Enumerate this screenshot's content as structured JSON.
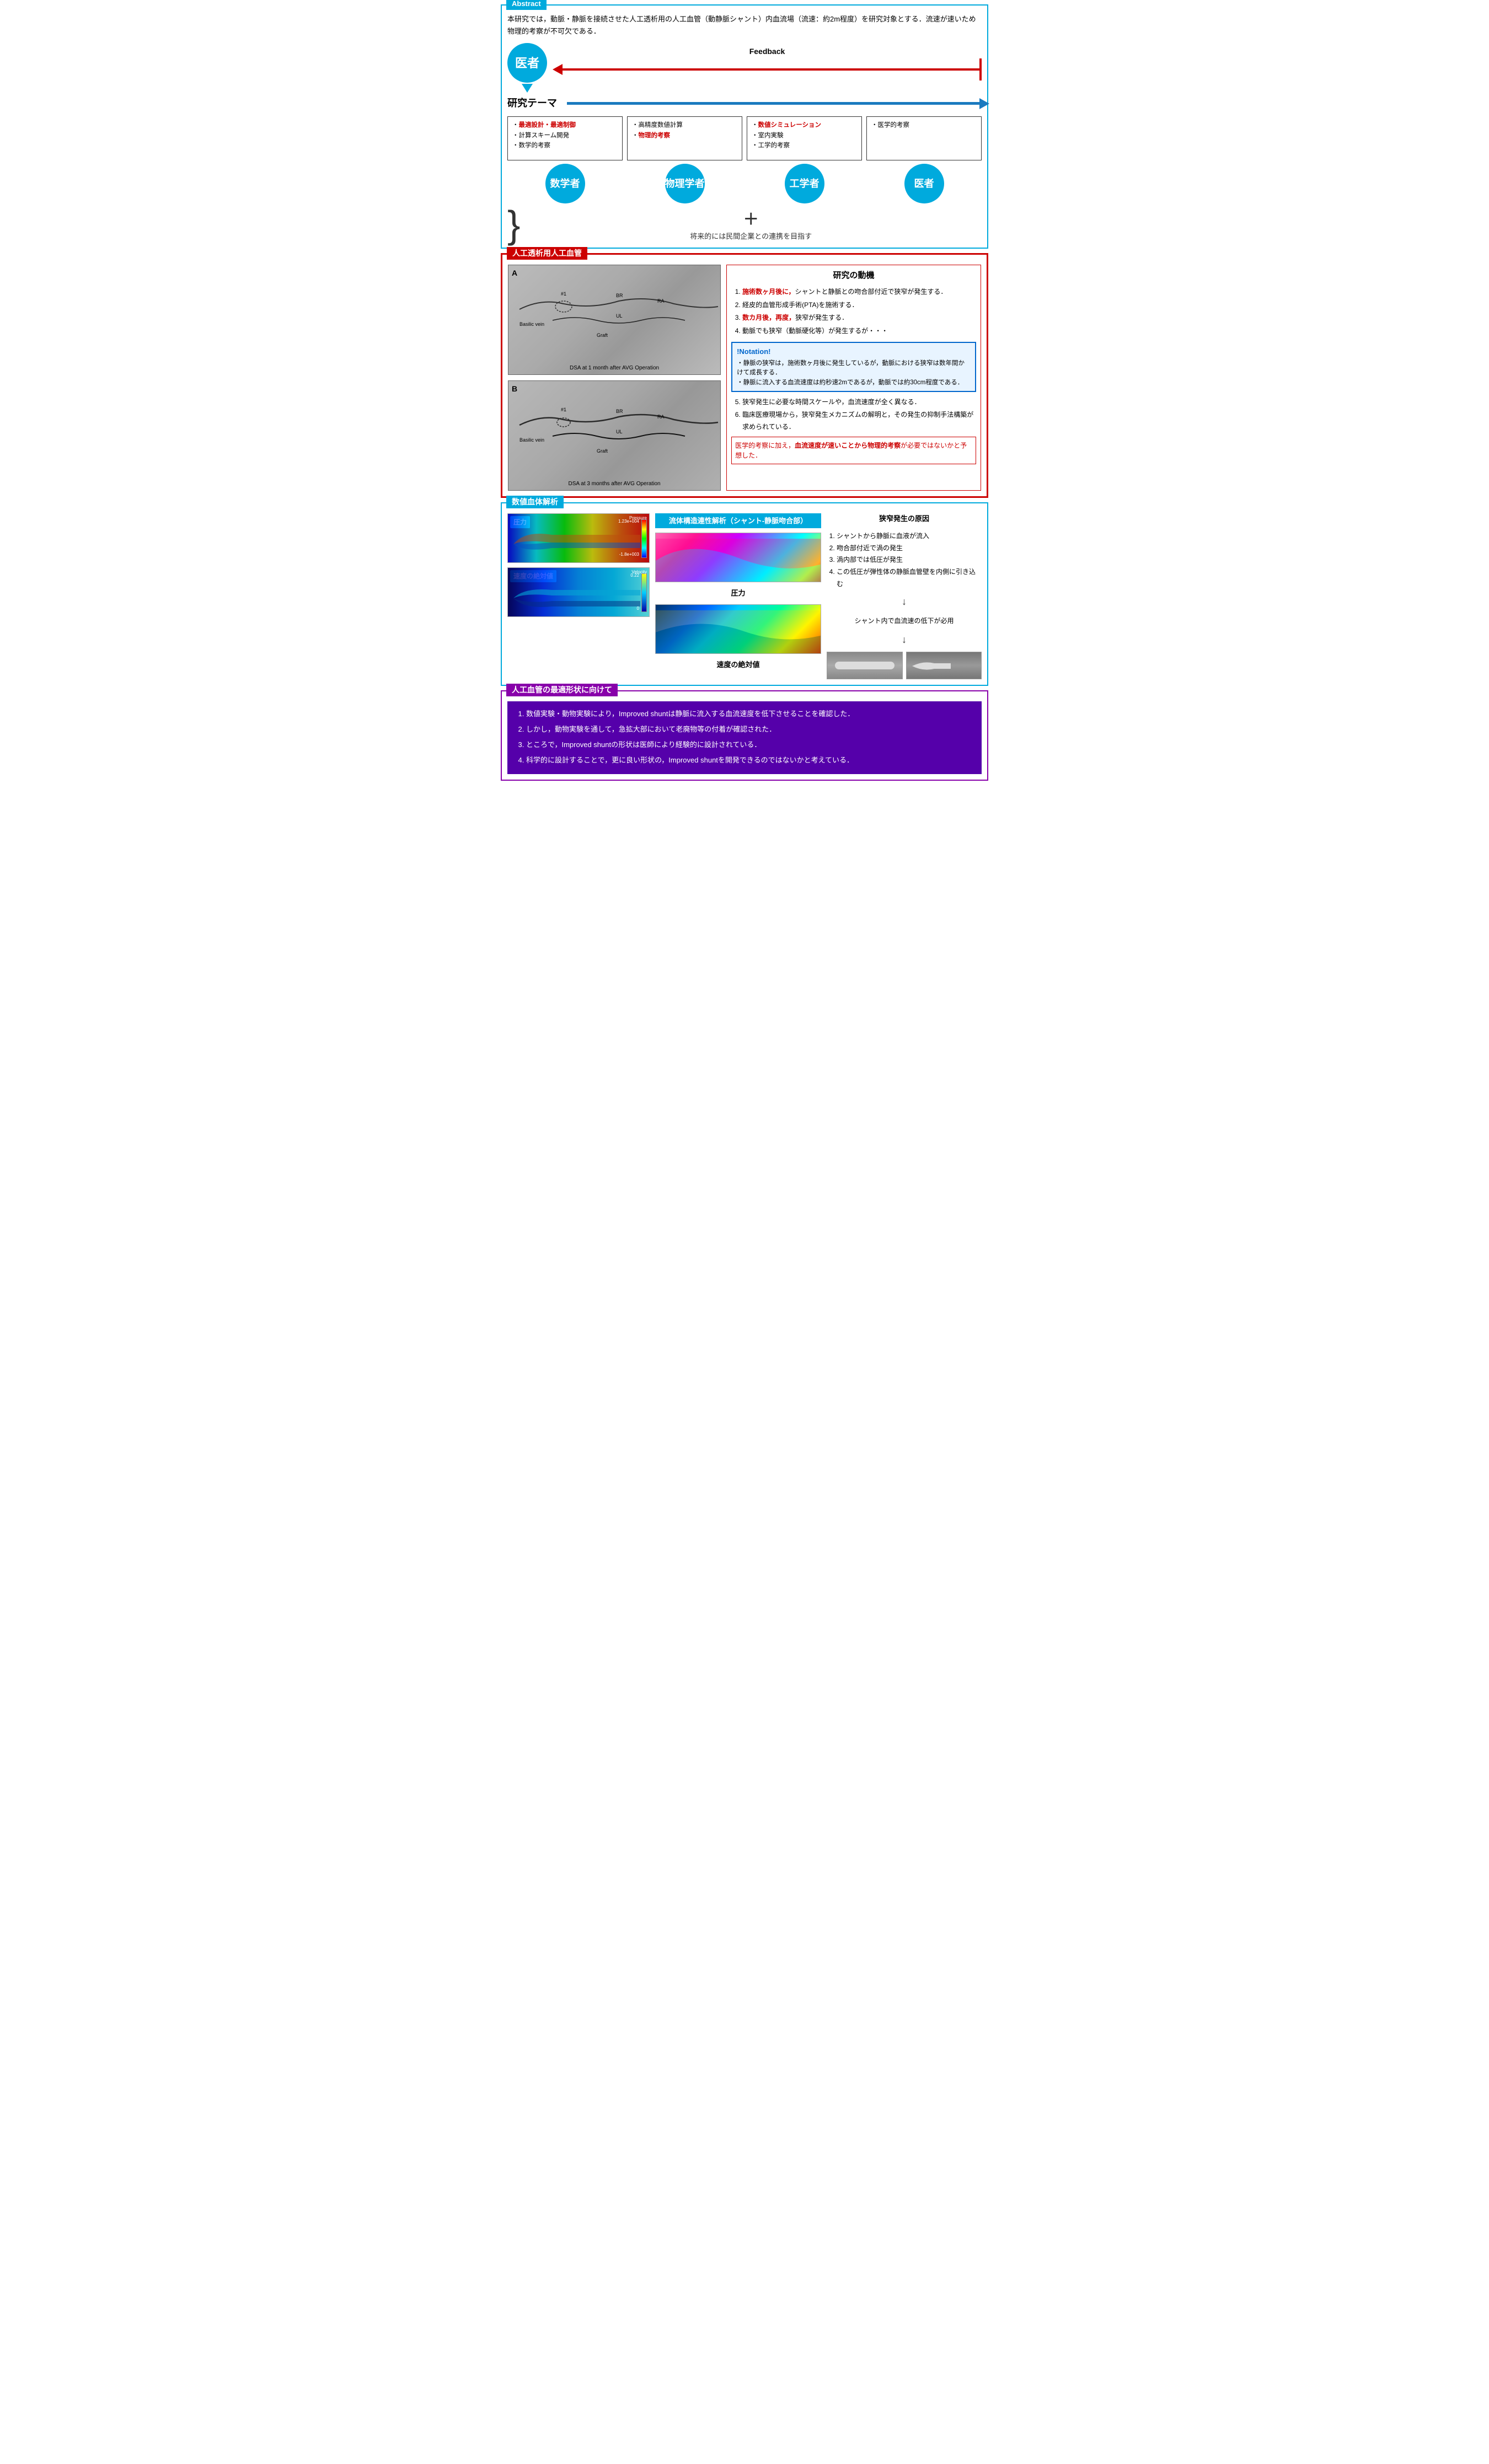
{
  "abstract": {
    "label": "Abstract",
    "text": "本研究では，動脈・静脈を接続させた人工透析用の人工血管（動静脈シャント）内血流場（流速：約2m程度）を研究対象とする．流速が速いため物理的考察が不可欠である．",
    "feedback_label": "Feedback",
    "theme_label": "研究テーマ",
    "collaboration": "将来的には民間企業との連携を目指す",
    "isha": "医者",
    "math": "数学者",
    "physics": "物理学者",
    "engineering": "工学者",
    "medicine": "医者",
    "math_items": [
      "最適設計・最適制御",
      "計算スキーム開発",
      "数学的考察"
    ],
    "physics_items": [
      "高精度数値計算",
      "物理的考察"
    ],
    "engineering_items": [
      "数値シミュレーション",
      "室内実験",
      "工学的考察"
    ],
    "medicine_items": [
      "医学的考察"
    ],
    "math_red": [
      0
    ],
    "physics_red": [
      1
    ],
    "engineering_red": [
      0
    ]
  },
  "hemodialysis": {
    "section_label": "人工透析用人工血管",
    "dsa_a_caption": "DSA at 1 month after AVG Operation",
    "dsa_b_caption": "DSA at 3 months after AVG Operation",
    "dsa_labels": [
      "Basilic vein",
      "BR",
      "UL",
      "RA",
      "Graft",
      "#1"
    ],
    "motivation_title": "研究の動機",
    "motivation_items": [
      "施術数ヶ月後に，シャントと静脈との吻合部付近で狭窄が発生する．",
      "経皮的血管形成手術(PTA)を施術する．",
      "数カ月後，再度，狭窄が発生する．",
      "動脈でも狭窄（動脈硬化等）が発生するが・・・"
    ],
    "motivation_red": [
      0,
      2
    ],
    "notation_title": "!Notation!",
    "notation_items": [
      "静脈の狭窄は，施術数ヶ月後に発生しているが，動脈における狭窄は数年間かけて成長する．",
      "静脈に流入する血流速度は約秒速2mであるが，動脈では約30cm程度である．"
    ],
    "motivation_items2": [
      "狭窄発生に必要な時間スケールや，血流速度が全く異なる．",
      "臨床医療現場から，狭窄発生メカニズムの解明と，その発生の抑制手法構築が求められている．"
    ],
    "footer": "医学的考察に加え，血流速度が速いことから物理的考察が必要ではないかと予想した．"
  },
  "numerical": {
    "section_label": "数値血体解析",
    "pressure_label": "圧力",
    "velocity_label": "速度の絶対値",
    "middle_title": "流体構造連性解析（シャント-静脈吻合部）",
    "middle_pressure": "圧力",
    "middle_velocity": "速度の絶対値",
    "pressure_max": "1.23e+004",
    "pressure_min": "-1.8e+003",
    "velocity_max": "0.22",
    "velocity_min": "0",
    "stenosis_title": "狭窄発生の原因",
    "stenosis_items": [
      "シャントから静脈に血液が流入",
      "吻合部付近で渦の発生",
      "渦内部では低圧が発生",
      "この低圧が弾性体の静脈血管壁を内側に引き込む"
    ],
    "stenosis_arrow": "シャント内で血流速の低下が必用"
  },
  "optimal": {
    "section_label": "人工血管の最適形状に向けて",
    "items": [
      "数値実験・動物実験により，Improved shuntは静脈に流入する血流速度を低下させることを確認した．",
      "しかし，動物実験を通して，急拡大部において老廃物等の付着が確認された．",
      "ところで，Improved shuntの形状は医師により経験的に設計されている．",
      "科学的に設計することで，更に良い形状の，Improved shuntを開発できるのではないかと考えている．"
    ]
  }
}
